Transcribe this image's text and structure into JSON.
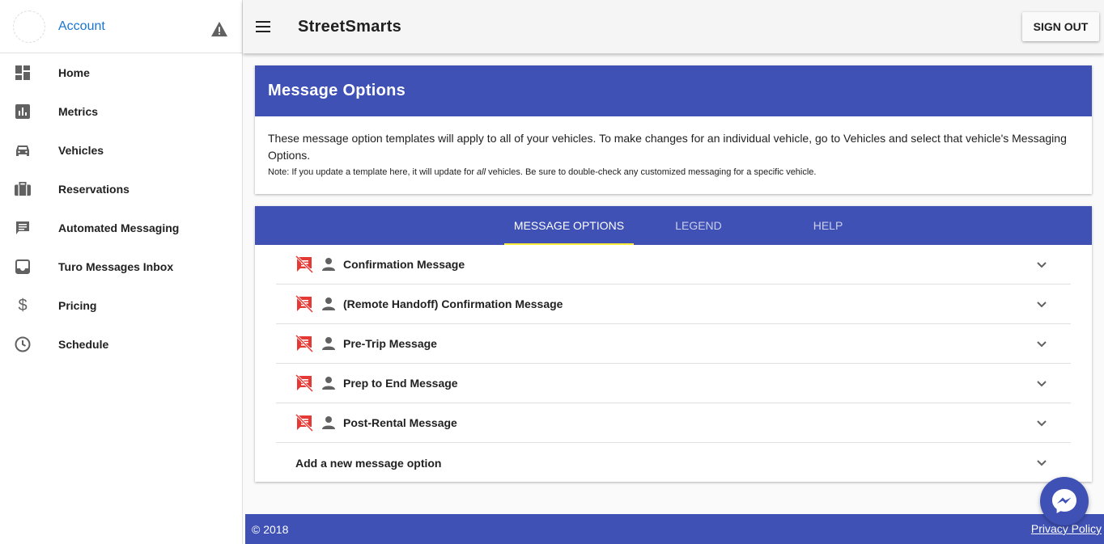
{
  "sidebar": {
    "account_label": "Account",
    "items": [
      {
        "label": "Home",
        "icon": "dashboard-icon"
      },
      {
        "label": "Metrics",
        "icon": "bar-chart-icon"
      },
      {
        "label": "Vehicles",
        "icon": "car-icon"
      },
      {
        "label": "Reservations",
        "icon": "briefcase-icon"
      },
      {
        "label": "Automated Messaging",
        "icon": "message-icon"
      },
      {
        "label": "Turo Messages Inbox",
        "icon": "inbox-icon"
      },
      {
        "label": "Pricing",
        "icon": "dollar-icon"
      },
      {
        "label": "Schedule",
        "icon": "clock-icon"
      }
    ]
  },
  "header": {
    "title": "StreetSmarts",
    "signout_label": "SIGN OUT"
  },
  "message_options_card": {
    "title": "Message Options",
    "description": "These message option templates will apply to all of your vehicles. To make changes for an individual vehicle, go to Vehicles and select that vehicle's Messaging Options.",
    "note_prefix": "Note: If you update a template here, it will update for ",
    "note_emphasis": "all",
    "note_suffix": " vehicles. Be sure to double-check any customized messaging for a specific vehicle."
  },
  "tabs": [
    {
      "label": "MESSAGE OPTIONS",
      "active": true
    },
    {
      "label": "LEGEND",
      "active": false
    },
    {
      "label": "HELP",
      "active": false
    }
  ],
  "messages": [
    {
      "label": "Confirmation Message"
    },
    {
      "label": "(Remote Handoff) Confirmation Message"
    },
    {
      "label": "Pre-Trip Message"
    },
    {
      "label": "Prep to End Message"
    },
    {
      "label": "Post-Rental Message"
    }
  ],
  "add_option_label": "Add a new message option",
  "footer": {
    "copyright": "© 2018",
    "privacy_label": "Privacy Policy"
  },
  "colors": {
    "primary": "#3f51b5",
    "tab_indicator": "#ffeb3b",
    "disabled_message_icon": "#e53935",
    "account_link": "#1976d2"
  }
}
